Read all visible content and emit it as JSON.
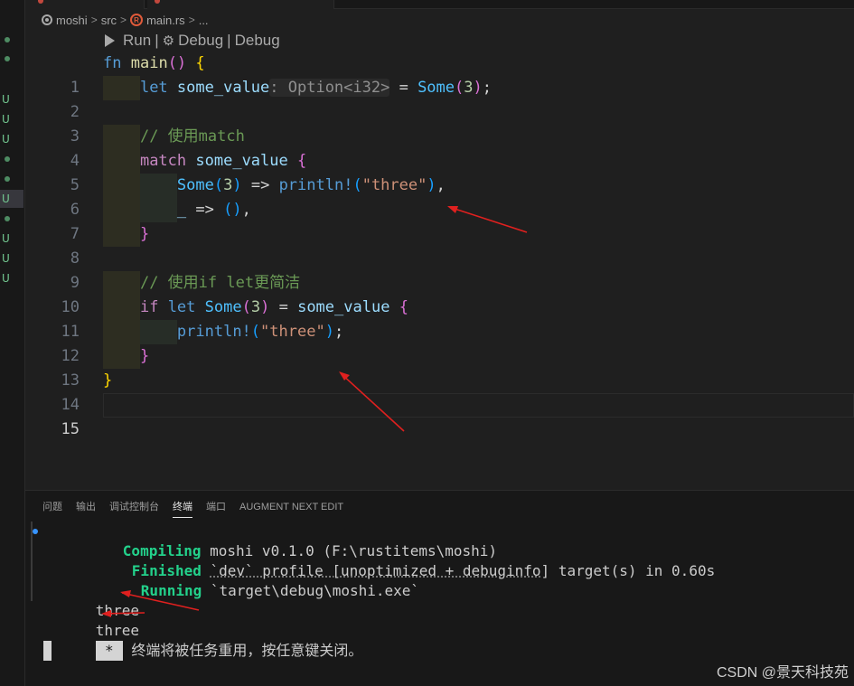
{
  "breadcrumb": {
    "folder": "moshi",
    "dir": "src",
    "file": "main.rs",
    "rest": "...",
    "sep": ">"
  },
  "codelens": {
    "run": "Run",
    "sep": "|",
    "debug1": "Debug",
    "debug2": "Debug"
  },
  "gutter_marks": [
    "U",
    "U",
    "U",
    "U",
    "U",
    "U",
    "U"
  ],
  "editor": {
    "line_numbers": [
      "1",
      "2",
      "3",
      "4",
      "5",
      "6",
      "7",
      "8",
      "9",
      "10",
      "11",
      "12",
      "13",
      "14",
      "15"
    ],
    "l1": {
      "fn": "fn",
      "name": "main",
      "parens": "()",
      "brace": "{"
    },
    "l2": {
      "let": "let",
      "var": "some_value",
      "hint": ": Option<i32>",
      "eq": " = ",
      "some": "Some",
      "p1": "(",
      "num": "3",
      "p2": ")",
      "semi": ";"
    },
    "l4": {
      "comment": "// 使用match"
    },
    "l5": {
      "match": "match",
      "var": "some_value",
      "brace": "{"
    },
    "l6": {
      "some": "Some",
      "p1": "(",
      "num": "3",
      "p2": ")",
      "arrow": " => ",
      "mac": "println!",
      "pp1": "(",
      "str": "\"three\"",
      "pp2": ")",
      "comma": ","
    },
    "l7": {
      "us": "_",
      "arrow": " => ",
      "unit": "()",
      "comma": ","
    },
    "l8": {
      "brace": "}"
    },
    "l10": {
      "comment_a": "// 使用",
      "comment_b": "if let",
      "comment_c": "更简洁"
    },
    "l11": {
      "if": "if",
      "let": "let",
      "some": "Some",
      "p1": "(",
      "num": "3",
      "p2": ")",
      "eq": " = ",
      "var": "some_value",
      "brace": "{"
    },
    "l12": {
      "mac": "println!",
      "p1": "(",
      "str": "\"three\"",
      "p2": ")",
      "semi": ";"
    },
    "l13": {
      "brace": "}"
    },
    "l14": {
      "brace": "}"
    }
  },
  "panel": {
    "tabs": [
      "问题",
      "输出",
      "调试控制台",
      "终端",
      "端口",
      "AUGMENT NEXT EDIT"
    ],
    "terminal": {
      "compiling_label": "Compiling",
      "compiling_rest": " moshi v0.1.0 (F:\\rustitems\\moshi)",
      "finished_label": "Finished",
      "finished_profile": "`dev` profile [unoptimized + debuginfo]",
      "finished_rest": " target(s) in 0.60s",
      "running_label": "Running",
      "running_rest": " `target\\debug\\moshi.exe`",
      "out1": "three",
      "out2": "three",
      "star": "*",
      "reuse_msg": " 终端将被任务重用，按任意键关闭。"
    }
  },
  "watermark": "CSDN @景天科技苑",
  "colors": {
    "background": "#1f1f1f",
    "keyword": "#569cd6",
    "control": "#c586c0",
    "string": "#ce9178",
    "comment": "#6a9955",
    "terminal_green": "#23d18b",
    "annotation_arrow": "#e0201f"
  }
}
